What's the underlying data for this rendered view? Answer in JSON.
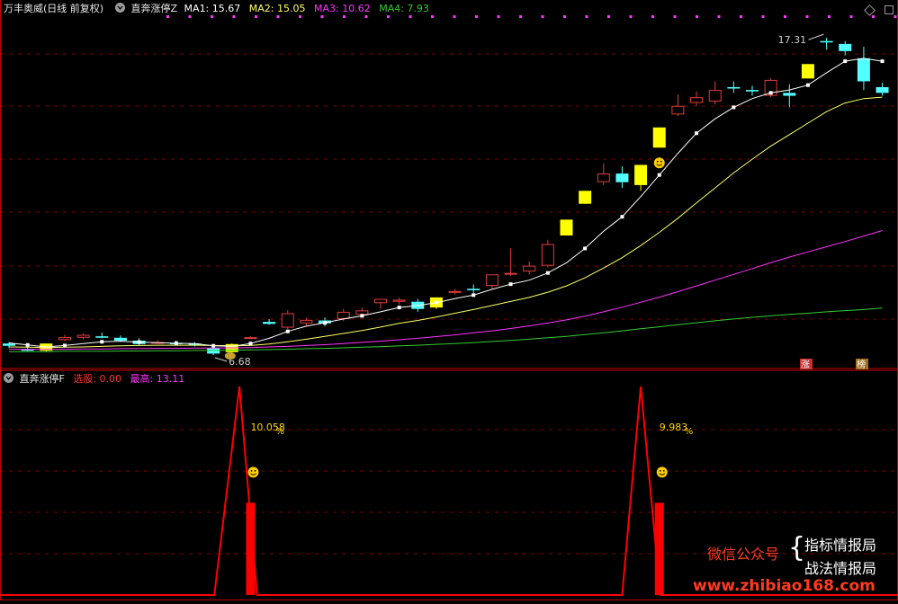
{
  "colors": {
    "bg": "#000000",
    "grid": "#7a0000",
    "border": "#c00000",
    "up": "#e03c3c",
    "down": "#54ffff",
    "signal": "#ffff00",
    "ma1": "#ffffff",
    "ma2": "#ffff66",
    "ma3": "#ff33ff",
    "ma4": "#33cc33",
    "marker": "#ff33ff",
    "indicator": "#ff0000"
  },
  "upper_header": {
    "stock": "万丰奥威",
    "period": "(日线 前复权)",
    "indicator": "直奔涨停Z",
    "ma1": "MA1: 15.67",
    "ma2": "MA2: 15.05",
    "ma3": "MA3: 10.62",
    "ma4": "MA4: 7.93"
  },
  "lower_header": {
    "indicator": "直奔涨停F",
    "xg": "选股: 0.00",
    "zg": "最高: 13.11"
  },
  "annotations": {
    "high_label": "17.31",
    "low_label": "6.68",
    "zhang_tag": "涨",
    "bang_tag": "榜",
    "pct1": "10.058",
    "pct2": "9.983",
    "pct_suffix": "%"
  },
  "icons": {
    "menu": "circle-chevron-icon",
    "window": "diamond-icon",
    "smiley": "smiley-icon"
  },
  "watermark": {
    "left": "微信公众号",
    "right1": "指标情报局",
    "right2": "战法情报局",
    "url": "www.zhibiao168.com"
  },
  "chart_data": [
    {
      "type": "candlestick",
      "name": "price",
      "ylim": [
        6.3,
        18.0
      ],
      "candles": [
        {
          "o": 6.7,
          "h": 6.75,
          "l": 6.55,
          "c": 6.62,
          "dir": "down"
        },
        {
          "o": 6.5,
          "h": 6.6,
          "l": 6.42,
          "c": 6.45,
          "dir": "down"
        },
        {
          "o": 6.45,
          "h": 6.6,
          "l": 6.4,
          "c": 6.7,
          "dir": "signal"
        },
        {
          "o": 6.82,
          "h": 7.0,
          "l": 6.78,
          "c": 6.92,
          "dir": "up"
        },
        {
          "o": 6.9,
          "h": 7.05,
          "l": 6.85,
          "c": 7.0,
          "dir": "up"
        },
        {
          "o": 6.95,
          "h": 7.08,
          "l": 6.88,
          "c": 6.9,
          "dir": "down"
        },
        {
          "o": 6.9,
          "h": 6.98,
          "l": 6.75,
          "c": 6.8,
          "dir": "down"
        },
        {
          "o": 6.8,
          "h": 6.88,
          "l": 6.62,
          "c": 6.68,
          "dir": "down"
        },
        {
          "o": 6.75,
          "h": 6.82,
          "l": 6.7,
          "c": 6.73,
          "dir": "up"
        },
        {
          "o": 6.72,
          "h": 6.8,
          "l": 6.65,
          "c": 6.7,
          "dir": "down"
        },
        {
          "o": 6.7,
          "h": 6.75,
          "l": 6.6,
          "c": 6.65,
          "dir": "down"
        },
        {
          "o": 6.55,
          "h": 6.6,
          "l": 6.3,
          "c": 6.35,
          "dir": "down"
        },
        {
          "o": 6.4,
          "h": 6.7,
          "l": 6.38,
          "c": 6.68,
          "dir": "signal"
        },
        {
          "o": 6.9,
          "h": 6.95,
          "l": 6.88,
          "c": 6.92,
          "dir": "up"
        },
        {
          "o": 7.45,
          "h": 7.55,
          "l": 7.35,
          "c": 7.38,
          "dir": "down"
        },
        {
          "o": 7.25,
          "h": 7.85,
          "l": 7.2,
          "c": 7.75,
          "dir": "up"
        },
        {
          "o": 7.4,
          "h": 7.6,
          "l": 7.32,
          "c": 7.52,
          "dir": "up"
        },
        {
          "o": 7.5,
          "h": 7.6,
          "l": 7.3,
          "c": 7.4,
          "dir": "down"
        },
        {
          "o": 7.55,
          "h": 7.9,
          "l": 7.48,
          "c": 7.8,
          "dir": "up"
        },
        {
          "o": 7.7,
          "h": 7.95,
          "l": 7.65,
          "c": 7.85,
          "dir": "up"
        },
        {
          "o": 8.1,
          "h": 8.2,
          "l": 7.9,
          "c": 8.25,
          "dir": "up"
        },
        {
          "o": 8.15,
          "h": 8.3,
          "l": 8.05,
          "c": 8.22,
          "dir": "up"
        },
        {
          "o": 8.15,
          "h": 8.25,
          "l": 7.8,
          "c": 7.9,
          "dir": "down"
        },
        {
          "o": 7.95,
          "h": 8.3,
          "l": 7.9,
          "c": 8.3,
          "dir": "signal"
        },
        {
          "o": 8.5,
          "h": 8.6,
          "l": 8.4,
          "c": 8.52,
          "dir": "up"
        },
        {
          "o": 8.55,
          "h": 8.75,
          "l": 8.45,
          "c": 8.6,
          "dir": "down"
        },
        {
          "o": 8.7,
          "h": 9.05,
          "l": 8.6,
          "c": 9.1,
          "dir": "up"
        },
        {
          "o": 9.1,
          "h": 10.0,
          "l": 9.05,
          "c": 9.15,
          "dir": "up"
        },
        {
          "o": 9.2,
          "h": 9.55,
          "l": 9.1,
          "c": 9.4,
          "dir": "up"
        },
        {
          "o": 9.4,
          "h": 10.3,
          "l": 9.35,
          "c": 10.15,
          "dir": "up"
        },
        {
          "o": 10.45,
          "h": 11.0,
          "l": 10.45,
          "c": 11.0,
          "dir": "signal"
        },
        {
          "o": 11.55,
          "h": 12.0,
          "l": 11.55,
          "c": 12.0,
          "dir": "signal"
        },
        {
          "o": 12.3,
          "h": 12.95,
          "l": 12.2,
          "c": 12.6,
          "dir": "up"
        },
        {
          "o": 12.6,
          "h": 12.85,
          "l": 12.1,
          "c": 12.3,
          "dir": "down"
        },
        {
          "o": 12.2,
          "h": 12.9,
          "l": 12.0,
          "c": 12.9,
          "dir": "signal"
        },
        {
          "o": 13.5,
          "h": 14.2,
          "l": 13.5,
          "c": 14.2,
          "dir": "signal"
        },
        {
          "o": 14.65,
          "h": 15.35,
          "l": 14.6,
          "c": 14.95,
          "dir": "up"
        },
        {
          "o": 15.05,
          "h": 15.45,
          "l": 14.95,
          "c": 15.25,
          "dir": "up"
        },
        {
          "o": 15.1,
          "h": 15.8,
          "l": 15.0,
          "c": 15.5,
          "dir": "up"
        },
        {
          "o": 15.6,
          "h": 15.8,
          "l": 15.4,
          "c": 15.55,
          "dir": "down"
        },
        {
          "o": 15.5,
          "h": 15.65,
          "l": 15.3,
          "c": 15.45,
          "dir": "down"
        },
        {
          "o": 15.3,
          "h": 15.9,
          "l": 15.25,
          "c": 15.85,
          "dir": "up"
        },
        {
          "o": 15.4,
          "h": 15.7,
          "l": 14.9,
          "c": 15.3,
          "dir": "down"
        },
        {
          "o": 15.9,
          "h": 16.4,
          "l": 15.9,
          "c": 16.4,
          "dir": "signal"
        },
        {
          "o": 17.15,
          "h": 17.31,
          "l": 16.9,
          "c": 17.2,
          "dir": "down"
        },
        {
          "o": 17.1,
          "h": 17.2,
          "l": 16.7,
          "c": 16.85,
          "dir": "down"
        },
        {
          "o": 16.6,
          "h": 17.0,
          "l": 15.5,
          "c": 15.8,
          "dir": "down"
        },
        {
          "o": 15.6,
          "h": 15.75,
          "l": 15.3,
          "c": 15.4,
          "dir": "down"
        }
      ],
      "ma1": [
        6.72,
        6.65,
        6.58,
        6.63,
        6.7,
        6.76,
        6.78,
        6.75,
        6.73,
        6.71,
        6.7,
        6.62,
        6.6,
        6.7,
        6.88,
        7.12,
        7.3,
        7.42,
        7.55,
        7.66,
        7.8,
        7.95,
        8.02,
        8.12,
        8.26,
        8.38,
        8.58,
        8.76,
        8.9,
        9.15,
        9.5,
        10.0,
        10.6,
        11.1,
        11.8,
        12.55,
        13.3,
        14.0,
        14.5,
        14.9,
        15.2,
        15.4,
        15.5,
        15.67,
        16.1,
        16.5,
        16.6,
        16.5
      ],
      "ma2": [
        6.58,
        6.57,
        6.56,
        6.57,
        6.58,
        6.6,
        6.62,
        6.63,
        6.64,
        6.64,
        6.64,
        6.63,
        6.62,
        6.63,
        6.68,
        6.76,
        6.85,
        6.95,
        7.05,
        7.15,
        7.27,
        7.4,
        7.5,
        7.62,
        7.75,
        7.88,
        8.02,
        8.16,
        8.3,
        8.48,
        8.7,
        8.98,
        9.32,
        9.68,
        10.1,
        10.56,
        11.05,
        11.58,
        12.1,
        12.62,
        13.1,
        13.55,
        13.95,
        14.35,
        14.75,
        15.05,
        15.2,
        15.25
      ],
      "ma3": [
        6.5,
        6.5,
        6.5,
        6.5,
        6.51,
        6.51,
        6.52,
        6.52,
        6.53,
        6.53,
        6.54,
        6.54,
        6.55,
        6.56,
        6.58,
        6.6,
        6.63,
        6.66,
        6.7,
        6.74,
        6.78,
        6.83,
        6.88,
        6.94,
        7.0,
        7.07,
        7.14,
        7.22,
        7.31,
        7.41,
        7.52,
        7.65,
        7.8,
        7.96,
        8.13,
        8.31,
        8.5,
        8.7,
        8.9,
        9.1,
        9.3,
        9.5,
        9.7,
        9.88,
        10.06,
        10.24,
        10.43,
        10.62
      ],
      "ma4": [
        6.42,
        6.42,
        6.42,
        6.43,
        6.43,
        6.43,
        6.44,
        6.44,
        6.45,
        6.45,
        6.46,
        6.46,
        6.47,
        6.48,
        6.49,
        6.5,
        6.52,
        6.53,
        6.55,
        6.57,
        6.59,
        6.62,
        6.64,
        6.67,
        6.7,
        6.73,
        6.77,
        6.81,
        6.85,
        6.9,
        6.95,
        7.01,
        7.07,
        7.14,
        7.21,
        7.28,
        7.35,
        7.42,
        7.49,
        7.55,
        7.61,
        7.66,
        7.71,
        7.75,
        7.8,
        7.84,
        7.88,
        7.93
      ],
      "signal_markers": [
        35
      ],
      "high_label_index": 44,
      "low_label_index": 11
    },
    {
      "type": "area",
      "name": "直奔涨停F",
      "ylim": [
        0,
        13.11
      ],
      "triangles": [
        {
          "start": 11.05,
          "peak": 12.4,
          "end": 13.35
        },
        {
          "start": 33.0,
          "peak": 34.0,
          "end": 35.05
        }
      ],
      "bars": [
        {
          "index": 13,
          "value": 5.8
        },
        {
          "index": 35,
          "value": 5.8
        }
      ],
      "pct_labels": [
        {
          "index": 13,
          "bind": "annotations.pct1"
        },
        {
          "index": 35,
          "bind": "annotations.pct2"
        }
      ]
    }
  ]
}
